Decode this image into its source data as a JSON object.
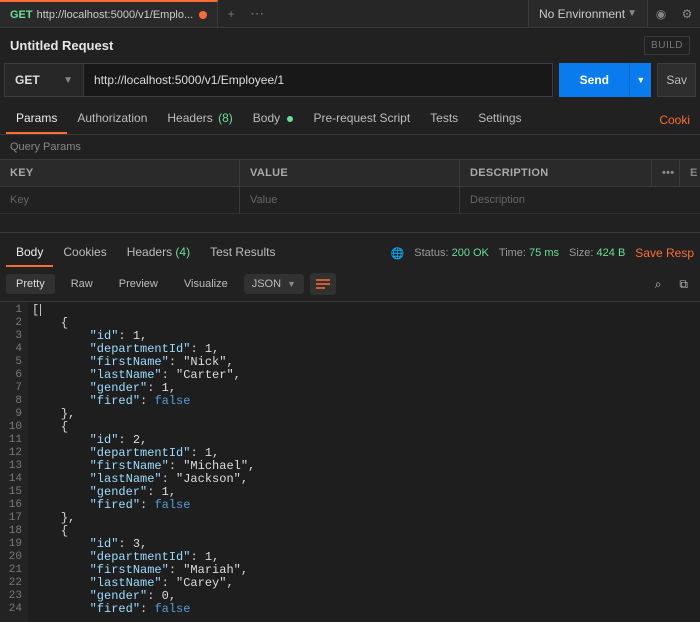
{
  "tab": {
    "method": "GET",
    "title": "http://localhost:5000/v1/Emplo...",
    "dirty": true
  },
  "env": {
    "label": "No Environment"
  },
  "request": {
    "title": "Untitled Request",
    "build_label": "BUILD",
    "method": "GET",
    "url": "http://localhost:5000/v1/Employee/1",
    "send_label": "Send",
    "save_label": "Sav"
  },
  "req_tabs": {
    "params": "Params",
    "authorization": "Authorization",
    "headers": "Headers",
    "headers_count": "(8)",
    "body": "Body",
    "prerequest": "Pre-request Script",
    "tests": "Tests",
    "settings": "Settings",
    "cookies_link": "Cooki"
  },
  "params": {
    "heading": "Query Params",
    "cols": {
      "key": "KEY",
      "value": "VALUE",
      "desc": "DESCRIPTION"
    },
    "placeholder": {
      "key": "Key",
      "value": "Value",
      "desc": "Description"
    },
    "menu": "•••",
    "bulk": "E"
  },
  "resp_tabs": {
    "body": "Body",
    "cookies": "Cookies",
    "headers": "Headers",
    "headers_count": "(4)",
    "tests": "Test Results"
  },
  "status": {
    "status_label": "Status:",
    "status_value": "200 OK",
    "time_label": "Time:",
    "time_value": "75 ms",
    "size_label": "Size:",
    "size_value": "424 B",
    "save_response": "Save Resp"
  },
  "viewbar": {
    "pretty": "Pretty",
    "raw": "Raw",
    "preview": "Preview",
    "visualize": "Visualize",
    "format": "JSON"
  },
  "code": {
    "totalLines": 24,
    "lines": [
      "[",
      "    {",
      "        \"id\": 1,",
      "        \"departmentId\": 1,",
      "        \"firstName\": \"Nick\",",
      "        \"lastName\": \"Carter\",",
      "        \"gender\": 1,",
      "        \"fired\": false",
      "    },",
      "    {",
      "        \"id\": 2,",
      "        \"departmentId\": 1,",
      "        \"firstName\": \"Michael\",",
      "        \"lastName\": \"Jackson\",",
      "        \"gender\": 1,",
      "        \"fired\": false",
      "    },",
      "    {",
      "        \"id\": 3,",
      "        \"departmentId\": 1,",
      "        \"firstName\": \"Mariah\",",
      "        \"lastName\": \"Carey\",",
      "        \"gender\": 0,",
      "        \"fired\": false"
    ]
  }
}
